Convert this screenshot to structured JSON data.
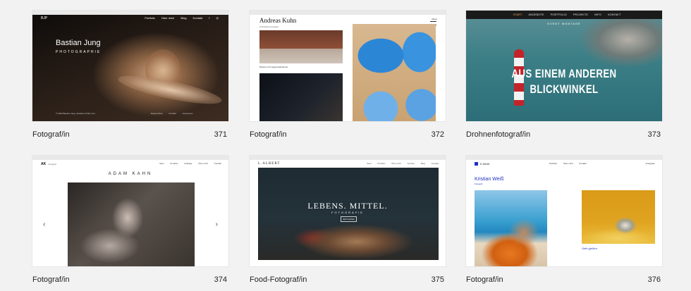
{
  "templates": [
    {
      "caption": "Fotograf/in",
      "number": "371",
      "site": {
        "logo": "BJP",
        "nav": [
          "Portfolio",
          "Über mich",
          "Blog",
          "Kontakt"
        ],
        "name": "Bastian Jung",
        "subtitle": "PHOTOGRAPHIE",
        "footer": "© 2023 Bastian Jung. Erstellt mit Wix.com",
        "footer_links": [
          "Datenschutz",
          "Kontakt",
          "Impressum"
        ]
      }
    },
    {
      "caption": "Fotograf/in",
      "number": "372",
      "site": {
        "name": "Andreas Kuhn",
        "subtitle": "Architektur-Fotograf",
        "menu": "Menü",
        "item_label": "Museum für Gegenwartskunst"
      }
    },
    {
      "caption": "Drohnenfotograf/in",
      "number": "373",
      "site": {
        "nav": [
          "START",
          "ANGEBOTE",
          "PORTFOLIO",
          "PROJEKTE",
          "INFO",
          "KONTAKT"
        ],
        "eyebrow": "EVENT MONTAGE",
        "headline_1": "AUS EINEM ANDEREN",
        "headline_2": "BLICKWINKEL"
      }
    },
    {
      "caption": "Fotograf/in",
      "number": "374",
      "site": {
        "logo": "AK",
        "logo_sub": "Fotograf",
        "nav": [
          "Start",
          "Portfolio",
          "Aufträge",
          "Über mich",
          "Kontakt"
        ],
        "name": "ADAM KAHN",
        "prev": "‹",
        "next": "›"
      }
    },
    {
      "caption": "Food-Fotograf/in",
      "number": "375",
      "site": {
        "logo": "L.ALBERT",
        "nav": [
          "Start",
          "Portfolio",
          "Über mich",
          "Kunden",
          "Blog",
          "Kontakt"
        ],
        "headline": "LEBENS. MITTEL.",
        "subtitle": "FOTOGRAFIE",
        "cta": "Jetzt buchen"
      }
    },
    {
      "caption": "Fotograf/in",
      "number": "376",
      "site": {
        "logo": "K.Weiß",
        "nav": [
          "Portfolio",
          "Über mich",
          "Kontakt"
        ],
        "social": "Instagram",
        "name": "Kristian Weiß",
        "subtitle": "Fotograf",
        "item_label": "Gelb gießen"
      }
    }
  ]
}
